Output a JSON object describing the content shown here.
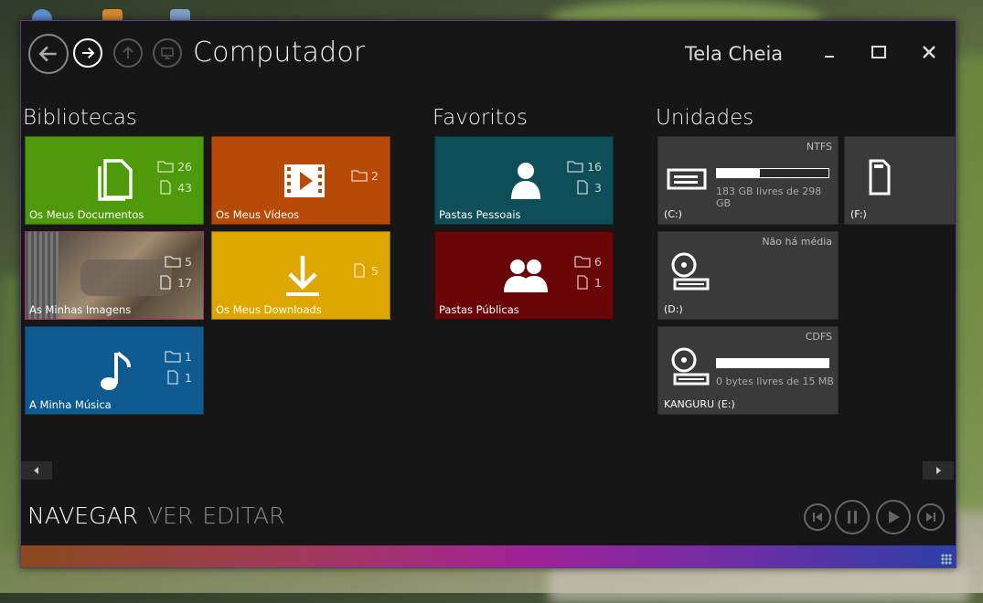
{
  "window": {
    "title": "Computador",
    "fullscreen_label": "Tela Cheia"
  },
  "sections": {
    "libraries": "Bibliotecas",
    "favorites": "Favoritos",
    "drives": "Unidades"
  },
  "libraries": [
    {
      "label": "Os Meus Documentos",
      "folders": "26",
      "files": "43",
      "color": "#4e9a0a",
      "icon": "documents-icon"
    },
    {
      "label": "Os Meus Vídeos",
      "folders": "2",
      "files": "",
      "color": "#b84a07",
      "icon": "video-icon"
    },
    {
      "label": "As Minhas Imagens",
      "folders": "5",
      "files": "17",
      "color": "#6a5a4a",
      "icon": "photo-thumbnail"
    },
    {
      "label": "Os Meus Downloads",
      "folders": "",
      "files": "5",
      "color": "#dea700",
      "icon": "download-icon"
    },
    {
      "label": "A Minha Música",
      "folders": "1",
      "files": "1",
      "color": "#0d5b91",
      "icon": "music-icon"
    }
  ],
  "favorites": [
    {
      "label": "Pastas Pessoais",
      "folders": "16",
      "files": "3",
      "color": "#0e4e58",
      "icon": "person-icon"
    },
    {
      "label": "Pastas Públicas",
      "folders": "6",
      "files": "1",
      "color": "#6a0508",
      "icon": "people-icon"
    }
  ],
  "drives": [
    {
      "label": "(C:)",
      "fs": "NTFS",
      "free_text": "183 GB livres de 298 GB",
      "used_fraction": 0.386,
      "icon": "hard-drive-icon"
    },
    {
      "label": "(F:)",
      "fs": "",
      "free_text": "",
      "icon": "sd-card-icon"
    },
    {
      "label": "(D:)",
      "fs": "Não há média",
      "free_text": "",
      "icon": "optical-drive-icon"
    },
    {
      "label": "KANGURU (E:)",
      "fs": "CDFS",
      "free_text": "0 bytes livres de 15 MB",
      "used_fraction": 1.0,
      "icon": "optical-drive-icon"
    }
  ],
  "bottom_nav": {
    "navigate": "NAVEGAR",
    "view": "VER",
    "edit": "EDITAR"
  },
  "colors": {
    "window_bg": "#161616",
    "drive_tile": "#3a3a3a",
    "accent_gradient_start": "#8a4a1c",
    "accent_gradient_end": "#2c3fa8"
  }
}
